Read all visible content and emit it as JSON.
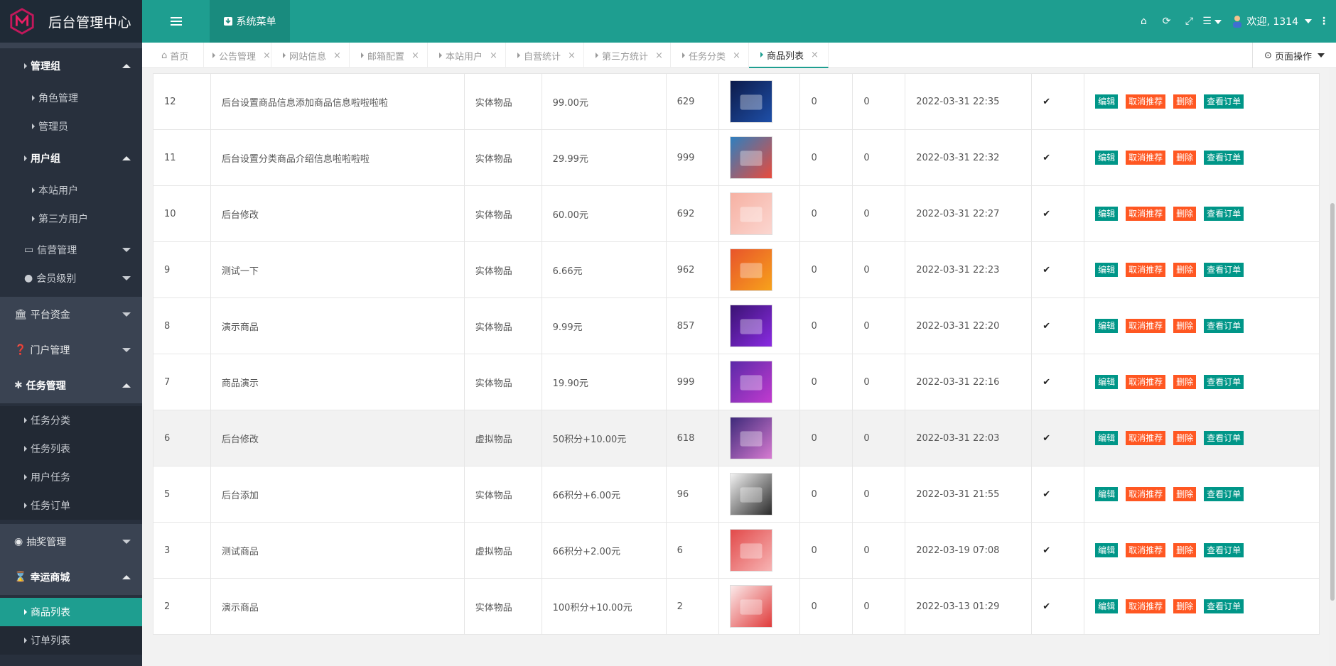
{
  "app": {
    "title": "后台管理中心"
  },
  "header": {
    "system_menu": "系统菜单",
    "user": "欢迎, 1314"
  },
  "sidebar": {
    "items": [
      {
        "label": "管理组",
        "type": "group"
      },
      {
        "label": "角色管理",
        "type": "sub"
      },
      {
        "label": "管理员",
        "type": "sub"
      },
      {
        "label": "用户组",
        "type": "group"
      },
      {
        "label": "本站用户",
        "type": "sub"
      },
      {
        "label": "第三方用户",
        "type": "sub"
      },
      {
        "label": "信营管理",
        "type": "sub-menu"
      },
      {
        "label": "会员级别",
        "type": "sub-menu"
      },
      {
        "label": "平台资金",
        "type": "top"
      },
      {
        "label": "门户管理",
        "type": "top"
      },
      {
        "label": "任务管理",
        "type": "top"
      },
      {
        "label": "任务分类",
        "type": "sub"
      },
      {
        "label": "任务列表",
        "type": "sub"
      },
      {
        "label": "用户任务",
        "type": "sub"
      },
      {
        "label": "任务订单",
        "type": "sub"
      },
      {
        "label": "抽奖管理",
        "type": "top"
      },
      {
        "label": "幸运商城",
        "type": "top"
      },
      {
        "label": "商品列表",
        "type": "sub"
      },
      {
        "label": "订单列表",
        "type": "sub"
      }
    ]
  },
  "tabs": [
    {
      "label": "首页"
    },
    {
      "label": "公告管理"
    },
    {
      "label": "网站信息"
    },
    {
      "label": "邮箱配置"
    },
    {
      "label": "本站用户"
    },
    {
      "label": "自营统计"
    },
    {
      "label": "第三方统计"
    },
    {
      "label": "任务分类"
    },
    {
      "label": "商品列表"
    }
  ],
  "page_ops": "页面操作",
  "actions": {
    "edit": "编辑",
    "unrecommend": "取消推荐",
    "delete": "删除",
    "view_orders": "查看订单"
  },
  "rows": [
    {
      "id": "12",
      "name": "后台设置商品信息添加商品信息啦啦啦啦",
      "type": "实体物品",
      "price": "99.00元",
      "stock": "629",
      "a": "0",
      "b": "0",
      "time": "2022-03-31 22:35"
    },
    {
      "id": "11",
      "name": "后台设置分类商品介绍信息啦啦啦啦",
      "type": "实体物品",
      "price": "29.99元",
      "stock": "999",
      "a": "0",
      "b": "0",
      "time": "2022-03-31 22:32"
    },
    {
      "id": "10",
      "name": "后台修改",
      "type": "实体物品",
      "price": "60.00元",
      "stock": "692",
      "a": "0",
      "b": "0",
      "time": "2022-03-31 22:27"
    },
    {
      "id": "9",
      "name": "测试一下",
      "type": "实体物品",
      "price": "6.66元",
      "stock": "962",
      "a": "0",
      "b": "0",
      "time": "2022-03-31 22:23"
    },
    {
      "id": "8",
      "name": "演示商品",
      "type": "实体物品",
      "price": "9.99元",
      "stock": "857",
      "a": "0",
      "b": "0",
      "time": "2022-03-31 22:20"
    },
    {
      "id": "7",
      "name": "商品演示",
      "type": "实体物品",
      "price": "19.90元",
      "stock": "999",
      "a": "0",
      "b": "0",
      "time": "2022-03-31 22:16"
    },
    {
      "id": "6",
      "name": "后台修改",
      "type": "虚拟物品",
      "price": "50积分+10.00元",
      "stock": "618",
      "a": "0",
      "b": "0",
      "time": "2022-03-31 22:03"
    },
    {
      "id": "5",
      "name": "后台添加",
      "type": "实体物品",
      "price": "66积分+6.00元",
      "stock": "96",
      "a": "0",
      "b": "0",
      "time": "2022-03-31 21:55"
    },
    {
      "id": "3",
      "name": "测试商品",
      "type": "虚拟物品",
      "price": "66积分+2.00元",
      "stock": "6",
      "a": "0",
      "b": "0",
      "time": "2022-03-19 07:08"
    },
    {
      "id": "2",
      "name": "演示商品",
      "type": "实体物品",
      "price": "100积分+10.00元",
      "stock": "2",
      "a": "0",
      "b": "0",
      "time": "2022-03-13 01:29"
    }
  ],
  "colors": {
    "accent": "#1e9e90",
    "button_teal": "#009688",
    "button_orange": "#ff5722",
    "sidebar_bg": "#28303d"
  }
}
